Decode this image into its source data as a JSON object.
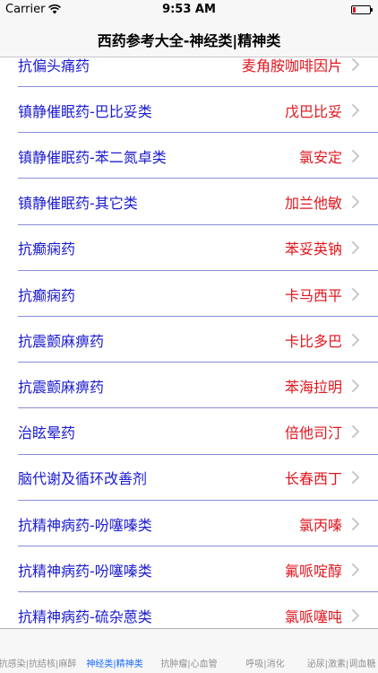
{
  "status_bar": {
    "carrier": "Carrier",
    "time": "9:53 AM"
  },
  "nav": {
    "title": "西药参考大全-神经类|精神类"
  },
  "list": {
    "items": [
      {
        "category": "抗偏头痛药",
        "drug": "麦角胺咖啡因片"
      },
      {
        "category": "镇静催眠药-巴比妥类",
        "drug": "戊巴比妥"
      },
      {
        "category": "镇静催眠药-苯二氮卓类",
        "drug": "氯安定"
      },
      {
        "category": "镇静催眠药-其它类",
        "drug": "加兰他敏"
      },
      {
        "category": "抗癫痫药",
        "drug": "苯妥英钠"
      },
      {
        "category": "抗癫痫药",
        "drug": "卡马西平"
      },
      {
        "category": "抗震颤麻痹药",
        "drug": "卡比多巴"
      },
      {
        "category": "抗震颤麻痹药",
        "drug": "苯海拉明"
      },
      {
        "category": "治眩晕药",
        "drug": "倍他司汀"
      },
      {
        "category": "脑代谢及循环改善剂",
        "drug": "长春西丁"
      },
      {
        "category": "抗精神病药-吩噻嗪类",
        "drug": "氯丙嗪"
      },
      {
        "category": "抗精神病药-吩噻嗪类",
        "drug": "氟哌啶醇"
      },
      {
        "category": "抗精神病药-硫杂蒽类",
        "drug": "氯哌噻吨"
      }
    ]
  },
  "tabs": [
    {
      "label": "抗感染|抗结核|麻醉",
      "active": false
    },
    {
      "label": "神经类|精神类",
      "active": true
    },
    {
      "label": "抗肿瘤|心血管",
      "active": false
    },
    {
      "label": "呼吸|消化",
      "active": false
    },
    {
      "label": "泌尿|激素|调血糖",
      "active": false
    }
  ],
  "colors": {
    "category_text": "#1b1bd0",
    "drug_text": "#e0161e",
    "separator": "#8b8bd6",
    "tab_active": "#1a6cff",
    "tab_inactive": "#929292",
    "battery_fill": "#e0161e"
  },
  "icons": {
    "row_accessory": "chevron-right-icon",
    "status_wifi": "wifi-icon",
    "status_battery": "battery-icon"
  }
}
